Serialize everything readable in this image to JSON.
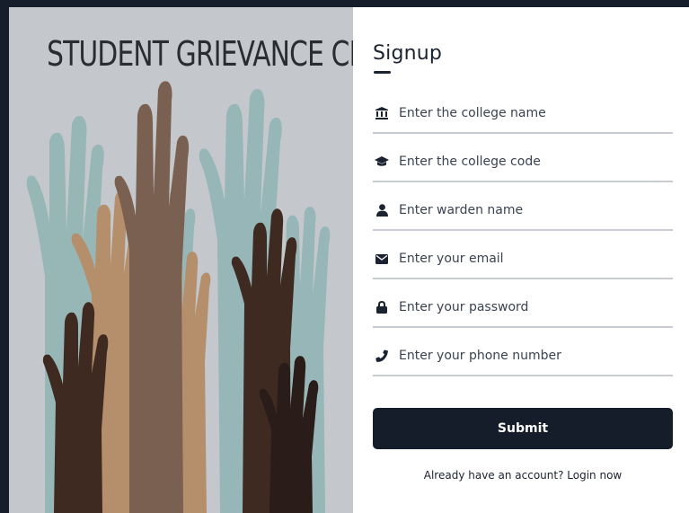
{
  "art": {
    "title": "STUDENT GRIEVANCE CELL",
    "background_color": "#c4c7cb"
  },
  "form": {
    "title": "Signup",
    "fields": [
      {
        "name": "college_name",
        "placeholder": "Enter the college name",
        "value": "",
        "icon": "institution-icon"
      },
      {
        "name": "college_code",
        "placeholder": "Enter the college code",
        "value": "",
        "icon": "graduation-cap-icon"
      },
      {
        "name": "warden_name",
        "placeholder": "Enter warden name",
        "value": "",
        "icon": "user-icon"
      },
      {
        "name": "email",
        "placeholder": "Enter your email",
        "value": "",
        "icon": "envelope-icon"
      },
      {
        "name": "password",
        "placeholder": "Enter your password",
        "value": "",
        "icon": "lock-icon"
      },
      {
        "name": "phone",
        "placeholder": "Enter your phone number",
        "value": "",
        "icon": "phone-icon"
      }
    ],
    "submit_label": "Submit",
    "login_prompt": "Already have an account?",
    "login_link": "Login now"
  },
  "colors": {
    "accent": "#151c2a",
    "page_background": "#161e2b",
    "card_background": "#ffffff",
    "field_border": "#c8ccd2"
  }
}
